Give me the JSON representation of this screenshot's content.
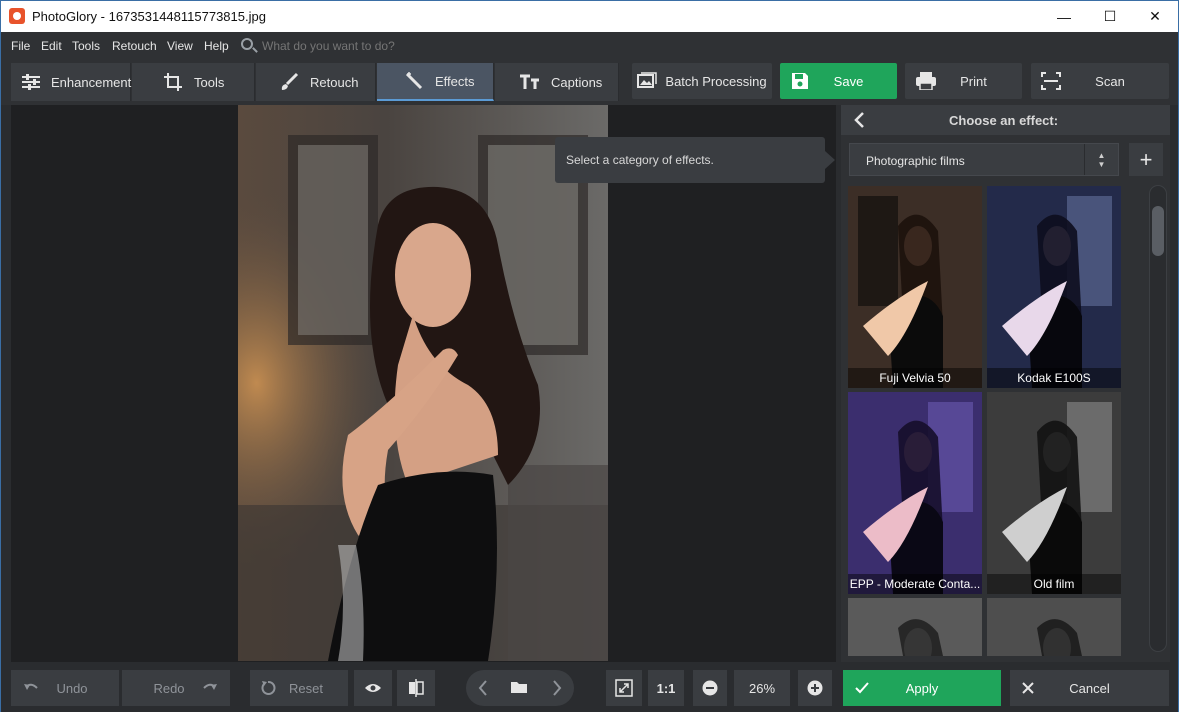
{
  "window": {
    "title": "PhotoGlory - 1673531448115773815.jpg",
    "minimize": "—",
    "maximize": "☐",
    "close": "✕"
  },
  "menu": {
    "items": [
      "File",
      "Edit",
      "Tools",
      "Retouch",
      "View",
      "Help"
    ],
    "search_placeholder": "What do you want to do?"
  },
  "toolbar": {
    "tabs": [
      {
        "label": "Enhancement",
        "icon": "sliders-icon"
      },
      {
        "label": "Tools",
        "icon": "crop-icon"
      },
      {
        "label": "Retouch",
        "icon": "brush-icon"
      },
      {
        "label": "Effects",
        "icon": "magic-wand-icon",
        "active": true
      },
      {
        "label": "Captions",
        "icon": "text-icon"
      }
    ],
    "batch_label": "Batch Processing",
    "save_label": "Save",
    "print_label": "Print",
    "scan_label": "Scan"
  },
  "tooltip": "Select a category of effects.",
  "panel": {
    "title": "Choose an effect:",
    "category": "Photographic films",
    "effects": [
      "Fuji Velvia 50",
      "Kodak E100S",
      "EPP - Moderate Conta...",
      "Old film",
      "",
      ""
    ]
  },
  "bottom": {
    "undo": "Undo",
    "redo": "Redo",
    "reset": "Reset",
    "ratio": "1:1",
    "zoom": "26%",
    "apply": "Apply",
    "cancel": "Cancel"
  },
  "colors": {
    "accent_green": "#1fa55b",
    "active_tab": "#4b5563",
    "background": "#2a2c2f"
  }
}
